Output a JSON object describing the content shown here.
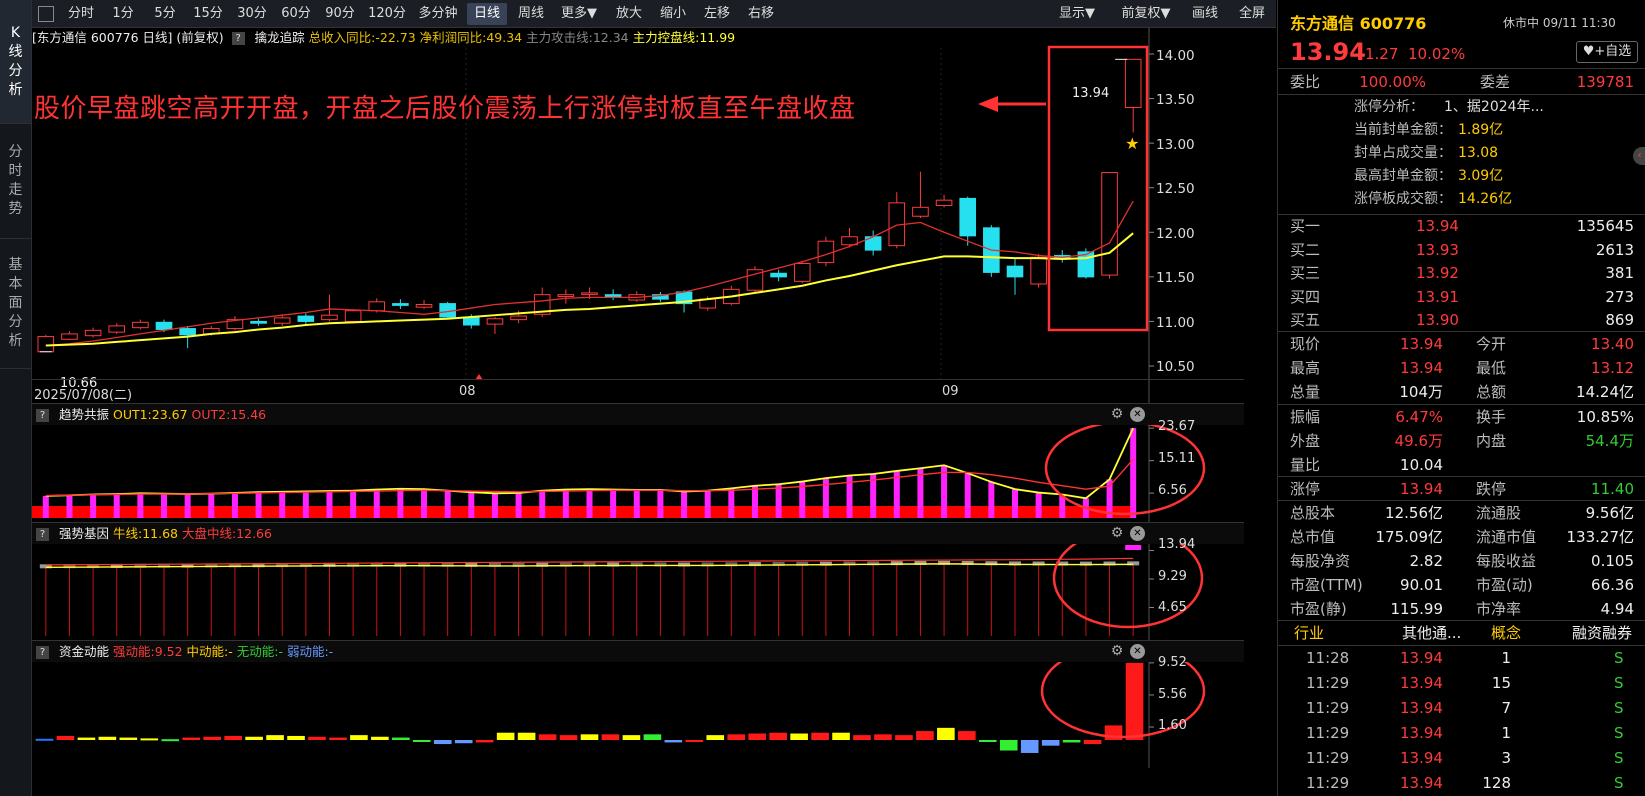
{
  "left_tabs": [
    {
      "label": "K线分析",
      "chars": [
        "K",
        "线",
        "分",
        "析"
      ],
      "active": true
    },
    {
      "label": "分时走势",
      "chars": [
        "分",
        "时",
        "走",
        "势"
      ],
      "active": false
    },
    {
      "label": "基本面分析",
      "chars": [
        "基",
        "本",
        "面",
        "分",
        "析"
      ],
      "active": false
    }
  ],
  "toolbar": {
    "periods": [
      "分时",
      "1分",
      "5分",
      "15分",
      "30分",
      "60分",
      "90分",
      "120分",
      "多分钟",
      "日线",
      "周线",
      "更多▼",
      "放大",
      "缩小",
      "左移",
      "右移"
    ],
    "active_period": "日线",
    "right_buttons": [
      "显示▼",
      "前复权▼",
      "画线",
      "全屏"
    ]
  },
  "chart": {
    "info": {
      "symbol_label": "[东方通信 600776 日线]",
      "adjust": "(前复权)",
      "indicator": "擒龙追踪",
      "revenue": "总收入同比:-22.73",
      "profit": "净利润同比:49.34",
      "attack": "主力攻击线:12.34",
      "control": "主力控盘线:11.99"
    },
    "annotation": "股价早盘跳空高开开盘，开盘之后股价震荡上行涨停封板直至午盘收盘",
    "high_label": "13.94",
    "low_label": "10.66",
    "start_date": "2025/07/08(二)",
    "month_labels": [
      "08",
      "09"
    ],
    "colors": {
      "up": "#ff3b3b",
      "down": "#27e0ef",
      "ma_short": "#e23030",
      "ma_long": "#ffff33",
      "accent_red": "#ff3333",
      "magenta": "#ff22ff"
    }
  },
  "chart_data": [
    {
      "type": "candlestick",
      "title": "东方通信 600776 日线",
      "ylim": [
        10.4,
        14.1
      ],
      "yticks": [
        "14.00",
        "13.50",
        "13.00",
        "12.50",
        "12.00",
        "11.50",
        "11.00",
        "10.50"
      ],
      "series": [
        {
          "name": "主力攻击线",
          "values": [
            10.73,
            10.75,
            10.78,
            10.82,
            10.86,
            10.9,
            10.94,
            10.98,
            11.01,
            11.04,
            11.07,
            11.1,
            11.14,
            11.13,
            11.12,
            11.1,
            11.08,
            11.11,
            11.15,
            11.19,
            11.21,
            11.23,
            11.26,
            11.27,
            11.27,
            11.27,
            11.29,
            11.33,
            11.39,
            11.46,
            11.53,
            11.6,
            11.67,
            11.75,
            11.84,
            11.95,
            12.08,
            12.11,
            12.0,
            11.9,
            11.8,
            11.78,
            11.74,
            11.72,
            11.75,
            11.88,
            12.35
          ]
        },
        {
          "name": "主力控盘线",
          "values": [
            10.73,
            10.74,
            10.75,
            10.77,
            10.79,
            10.81,
            10.83,
            10.86,
            10.88,
            10.91,
            10.93,
            10.96,
            10.98,
            10.99,
            11.0,
            11.01,
            11.02,
            11.03,
            11.05,
            11.07,
            11.09,
            11.11,
            11.13,
            11.14,
            11.16,
            11.18,
            11.2,
            11.22,
            11.25,
            11.28,
            11.32,
            11.36,
            11.4,
            11.46,
            11.51,
            11.57,
            11.63,
            11.68,
            11.73,
            11.73,
            11.72,
            11.71,
            11.71,
            11.7,
            11.71,
            11.77,
            11.99
          ]
        }
      ],
      "candles": [
        [
          10.66,
          10.83,
          10.66,
          10.85
        ],
        [
          10.8,
          10.86,
          10.79,
          10.89
        ],
        [
          10.84,
          10.9,
          10.82,
          10.93
        ],
        [
          10.88,
          10.95,
          10.86,
          10.98
        ],
        [
          10.93,
          10.99,
          10.91,
          11.02
        ],
        [
          10.99,
          10.91,
          10.88,
          11.02
        ],
        [
          10.92,
          10.85,
          10.7,
          10.95
        ],
        [
          10.86,
          10.92,
          10.84,
          10.95
        ],
        [
          10.92,
          11.02,
          10.9,
          11.06
        ],
        [
          11.0,
          10.98,
          10.95,
          11.03
        ],
        [
          10.98,
          11.04,
          10.95,
          11.08
        ],
        [
          11.06,
          11.0,
          10.97,
          11.09
        ],
        [
          11.02,
          11.07,
          11.0,
          11.3
        ],
        [
          11.0,
          11.12,
          10.98,
          11.14
        ],
        [
          11.12,
          11.22,
          11.1,
          11.26
        ],
        [
          11.2,
          11.18,
          11.14,
          11.25
        ],
        [
          11.16,
          11.19,
          11.14,
          11.24
        ],
        [
          11.2,
          11.05,
          11.03,
          11.22
        ],
        [
          11.05,
          10.96,
          10.92,
          11.08
        ],
        [
          10.97,
          11.03,
          10.86,
          11.05
        ],
        [
          11.02,
          11.06,
          10.98,
          11.12
        ],
        [
          11.08,
          11.3,
          11.05,
          11.38
        ],
        [
          11.28,
          11.3,
          11.2,
          11.36
        ],
        [
          11.32,
          11.32,
          11.25,
          11.38
        ],
        [
          11.3,
          11.27,
          11.24,
          11.36
        ],
        [
          11.24,
          11.3,
          11.22,
          11.34
        ],
        [
          11.3,
          11.25,
          11.22,
          11.33
        ],
        [
          11.33,
          11.2,
          11.1,
          11.35
        ],
        [
          11.15,
          11.25,
          11.12,
          11.28
        ],
        [
          11.2,
          11.36,
          11.18,
          11.4
        ],
        [
          11.35,
          11.58,
          11.33,
          11.62
        ],
        [
          11.54,
          11.5,
          11.45,
          11.58
        ],
        [
          11.45,
          11.65,
          11.43,
          11.68
        ],
        [
          11.66,
          11.9,
          11.62,
          11.95
        ],
        [
          11.86,
          11.95,
          11.83,
          12.05
        ],
        [
          11.95,
          11.8,
          11.74,
          12.02
        ],
        [
          11.85,
          12.33,
          11.82,
          12.45
        ],
        [
          12.18,
          12.28,
          12.16,
          12.68
        ],
        [
          12.3,
          12.36,
          12.28,
          12.42
        ],
        [
          12.38,
          11.96,
          11.85,
          12.4
        ],
        [
          12.05,
          11.55,
          11.5,
          12.08
        ],
        [
          11.62,
          11.5,
          11.3,
          11.7
        ],
        [
          11.42,
          11.72,
          11.38,
          11.76
        ],
        [
          11.74,
          11.7,
          11.66,
          11.8
        ],
        [
          11.78,
          11.5,
          11.48,
          11.82
        ],
        [
          11.52,
          12.67,
          11.48,
          12.67
        ],
        [
          13.4,
          13.94,
          13.12,
          13.94
        ]
      ],
      "columns": [
        "open",
        "close",
        "low",
        "high"
      ]
    },
    {
      "type": "bar",
      "title": "趋势共振",
      "ylim": [
        0,
        24.5
      ],
      "yticks": [
        "23.67",
        "15.11",
        "6.56"
      ],
      "series": [
        {
          "name": "OUT1",
          "values": [
            5.8,
            6.0,
            6.2,
            6.3,
            6.5,
            6.4,
            6.3,
            6.4,
            6.6,
            6.8,
            6.9,
            7.0,
            7.1,
            7.2,
            7.5,
            7.7,
            7.6,
            7.2,
            6.8,
            6.5,
            6.6,
            7.2,
            7.5,
            7.6,
            7.5,
            7.4,
            7.4,
            7.0,
            7.2,
            7.8,
            8.5,
            8.9,
            9.6,
            10.5,
            11.2,
            11.6,
            12.4,
            13.1,
            13.9,
            11.8,
            9.5,
            7.6,
            6.7,
            6.2,
            5.2,
            10.2,
            23.67
          ]
        },
        {
          "name": "OUT2",
          "values": [
            5.9,
            6.0,
            6.1,
            6.2,
            6.3,
            6.3,
            6.3,
            6.4,
            6.5,
            6.6,
            6.7,
            6.8,
            6.9,
            7.0,
            7.1,
            7.2,
            7.3,
            7.2,
            7.1,
            7.0,
            6.9,
            7.0,
            7.1,
            7.2,
            7.3,
            7.3,
            7.3,
            7.2,
            7.2,
            7.3,
            7.6,
            7.9,
            8.3,
            8.8,
            9.4,
            10.0,
            10.7,
            11.4,
            12.0,
            12.0,
            11.4,
            10.5,
            9.4,
            8.5,
            7.6,
            8.4,
            15.46
          ]
        }
      ]
    },
    {
      "type": "bar",
      "title": "强势基因",
      "ylim": [
        0,
        15
      ],
      "yticks": [
        "13.94",
        "9.29",
        "4.65"
      ],
      "series": [
        {
          "name": "牛线",
          "values": [
            11.2,
            11.22,
            11.24,
            11.26,
            11.28,
            11.3,
            11.32,
            11.34,
            11.36,
            11.38,
            11.4,
            11.42,
            11.44,
            11.45,
            11.46,
            11.46,
            11.46,
            11.45,
            11.44,
            11.43,
            11.43,
            11.45,
            11.47,
            11.48,
            11.49,
            11.5,
            11.5,
            11.5,
            11.51,
            11.53,
            11.56,
            11.58,
            11.6,
            11.63,
            11.66,
            11.69,
            11.72,
            11.74,
            11.76,
            11.74,
            11.7,
            11.67,
            11.66,
            11.65,
            11.64,
            11.66,
            11.68
          ]
        },
        {
          "name": "大盘中线",
          "values": [
            11.6,
            11.62,
            11.64,
            11.66,
            11.68,
            11.7,
            11.72,
            11.74,
            11.76,
            11.78,
            11.8,
            11.82,
            11.85,
            11.87,
            11.9,
            11.92,
            11.94,
            11.96,
            11.98,
            12.0,
            12.02,
            12.04,
            12.06,
            12.08,
            12.1,
            12.12,
            12.14,
            12.16,
            12.18,
            12.2,
            12.22,
            12.24,
            12.26,
            12.28,
            12.3,
            12.32,
            12.34,
            12.36,
            12.38,
            12.4,
            12.42,
            12.44,
            12.46,
            12.5,
            12.54,
            12.6,
            12.66
          ]
        }
      ]
    },
    {
      "type": "bar",
      "title": "资金动能",
      "ylim": [
        -2,
        10
      ],
      "yticks": [
        "9.52",
        "5.56",
        "1.60"
      ],
      "series": [
        {
          "name": "强动能",
          "values": [
            0.15,
            0.5,
            0.3,
            0.4,
            0.3,
            0.2,
            0.1,
            0.3,
            0.4,
            0.5,
            0.4,
            0.6,
            0.5,
            0.4,
            0.3,
            0.6,
            0.4,
            0.3,
            -0.2,
            -0.5,
            -0.4,
            -0.3,
            0.9,
            0.9,
            0.7,
            0.6,
            0.7,
            0.7,
            0.6,
            0.7,
            -0.3,
            -0.2,
            0.6,
            0.7,
            0.8,
            0.9,
            0.8,
            0.9,
            0.9,
            0.6,
            0.7,
            0.6,
            1.1,
            1.5,
            1.1,
            -0.1,
            -1.3,
            -1.6,
            -0.7,
            -0.3,
            -0.5,
            1.8,
            9.52
          ]
        }
      ],
      "bar_colors": [
        "#2277ff",
        "#ff1a1a",
        "#ffff00",
        "#ffff00",
        "#ffff00",
        "#ffff00",
        "#33ee33",
        "#ff1a1a",
        "#ff1a1a",
        "#ff1a1a",
        "#ffff00",
        "#ffff00",
        "#ffff00",
        "#ff1a1a",
        "#ff1a1a",
        "#ffff00",
        "#ffff00",
        "#33ee33",
        "#33ee33",
        "#6699ff",
        "#6699ff",
        "#ff1a1a",
        "#ffff00",
        "#ffff00",
        "#ff1a1a",
        "#ff1a1a",
        "#ffff00",
        "#ff1a1a",
        "#ffff00",
        "#33ee33",
        "#6699ff",
        "#ff1a1a",
        "#ffff00",
        "#ff1a1a",
        "#ff1a1a",
        "#ff1a1a",
        "#ffff00",
        "#ff1a1a",
        "#ffff00",
        "#ff1a1a",
        "#ff1a1a",
        "#ff1a1a",
        "#ff1a1a",
        "#ffff00",
        "#ff1a1a",
        "#33ee33",
        "#33ee33",
        "#6699ff",
        "#6699ff",
        "#33ee33",
        "#ff1a1a",
        "#ff1a1a"
      ]
    }
  ],
  "panels": {
    "trend": {
      "name": "趋势共振",
      "out1": "OUT1:23.67",
      "out2": "OUT2:15.46"
    },
    "gene": {
      "name": "强势基因",
      "bull": "牛线:11.68",
      "market": "大盘中线:12.66"
    },
    "fund": {
      "name": "资金动能",
      "strong": "强动能:9.52",
      "mid": "中动能:-",
      "none": "无动能:-",
      "weak": "弱动能:-"
    }
  },
  "quote": {
    "name": "东方通信 600776",
    "status": "休市中 09/11 11:30",
    "price": "13.94",
    "change": "1.27",
    "pct": "10.02%",
    "watch": "♥+自选",
    "weibi_label": "委比",
    "weibi": "100.00%",
    "weicha_label": "委差",
    "weicha": "139781",
    "limit_analysis": {
      "title": "涨停分析：",
      "title_value": "1、据2024年...",
      "items": [
        {
          "label": "当前封单金额：",
          "value": "1.89亿"
        },
        {
          "label": "封单占成交量：",
          "value": "13.08"
        },
        {
          "label": "最高封单金额：",
          "value": "3.09亿"
        },
        {
          "label": "涨停板成交额：",
          "value": "14.26亿"
        }
      ]
    },
    "bids": [
      {
        "label": "买一",
        "price": "13.94",
        "vol": "135645"
      },
      {
        "label": "买二",
        "price": "13.93",
        "vol": "2613"
      },
      {
        "label": "买三",
        "price": "13.92",
        "vol": "381"
      },
      {
        "label": "买四",
        "price": "13.91",
        "vol": "273"
      },
      {
        "label": "买五",
        "price": "13.90",
        "vol": "869"
      }
    ],
    "stats1": [
      {
        "l1": "现价",
        "v1": "13.94",
        "c1": "red",
        "l2": "今开",
        "v2": "13.40",
        "c2": "red"
      },
      {
        "l1": "最高",
        "v1": "13.94",
        "c1": "red",
        "l2": "最低",
        "v2": "13.12",
        "c2": "red"
      },
      {
        "l1": "总量",
        "v1": "104万",
        "c1": "white",
        "l2": "总额",
        "v2": "14.24亿",
        "c2": "white"
      }
    ],
    "stats2": [
      {
        "l1": "振幅",
        "v1": "6.47%",
        "c1": "red",
        "l2": "换手",
        "v2": "10.85%",
        "c2": "white"
      },
      {
        "l1": "外盘",
        "v1": "49.6万",
        "c1": "red",
        "l2": "内盘",
        "v2": "54.4万",
        "c2": "green"
      },
      {
        "l1": "量比",
        "v1": "10.04",
        "c1": "white",
        "l2": "",
        "v2": "",
        "c2": "white"
      }
    ],
    "stats3": [
      {
        "l1": "涨停",
        "v1": "13.94",
        "c1": "red",
        "l2": "跌停",
        "v2": "11.40",
        "c2": "green"
      }
    ],
    "stats4": [
      {
        "l1": "总股本",
        "v1": "12.56亿",
        "c1": "white",
        "l2": "流通股",
        "v2": "9.56亿",
        "c2": "white"
      },
      {
        "l1": "总市值",
        "v1": "175.09亿",
        "c1": "white",
        "l2": "流通市值",
        "v2": "133.27亿",
        "c2": "white"
      },
      {
        "l1": "每股净资",
        "v1": "2.82",
        "c1": "white",
        "l2": "每股收益",
        "v2": "0.105",
        "c2": "white"
      },
      {
        "l1": "市盈(TTM)",
        "v1": "90.01",
        "c1": "white",
        "l2": "市盈(动)",
        "v2": "66.36",
        "c2": "white"
      },
      {
        "l1": "市盈(静)",
        "v1": "115.99",
        "c1": "white",
        "l2": "市净率",
        "v2": "4.94",
        "c2": "white"
      }
    ],
    "tags": [
      "行业",
      "其他通...",
      "概念",
      "融资融券"
    ],
    "ticks": [
      {
        "time": "11:28",
        "price": "13.94",
        "vol": "1",
        "side": "S"
      },
      {
        "time": "11:29",
        "price": "13.94",
        "vol": "15",
        "side": "S"
      },
      {
        "time": "11:29",
        "price": "13.94",
        "vol": "7",
        "side": "S"
      },
      {
        "time": "11:29",
        "price": "13.94",
        "vol": "1",
        "side": "S"
      },
      {
        "time": "11:29",
        "price": "13.94",
        "vol": "3",
        "side": "S"
      },
      {
        "time": "11:29",
        "price": "13.94",
        "vol": "128",
        "side": "S"
      }
    ]
  }
}
